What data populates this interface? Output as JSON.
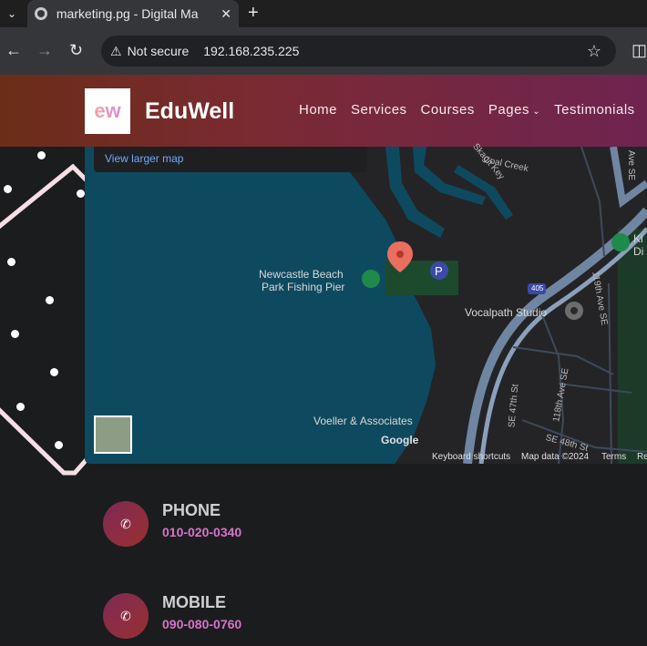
{
  "browser": {
    "tab_title": "marketing.pg - Digital Ma",
    "new_tab_label": "+",
    "security_label": "Not secure",
    "url": "192.168.235.225"
  },
  "header": {
    "logo_text": "ew",
    "brand": "EduWell",
    "nav": [
      "Home",
      "Services",
      "Courses",
      "Pages",
      "Testimonials"
    ]
  },
  "map": {
    "view_larger": "View larger map",
    "labels": {
      "newcastle_1": "Newcastle Beach",
      "newcastle_2": "Park Fishing Pier",
      "vocalpath": "Vocalpath Studio",
      "voeller": "Voeller & Associates",
      "coal_creek": "Coal Creek",
      "skagit": "Skagit Key",
      "ave_se": "Ave SE",
      "ave_119": "119th Ave SE",
      "ave_118": "118th Ave SE",
      "se_47": "SE 47th St",
      "se_48": "SE 48th St",
      "i405": "405",
      "google": "Google",
      "ki": "Ki",
      "di": "Di"
    },
    "attribution": {
      "keyboard": "Keyboard shortcuts",
      "data": "Map data ©2024",
      "terms": "Terms",
      "report": "Re"
    }
  },
  "contacts": [
    {
      "label": "PHONE",
      "value": "010-020-0340"
    },
    {
      "label": "MOBILE",
      "value": "090-080-0760"
    }
  ],
  "colors": {
    "header_gradient_start": "#6b2d17",
    "header_gradient_end": "#6f2450",
    "accent_pink": "#d774c9",
    "water": "#0e4a5f"
  }
}
